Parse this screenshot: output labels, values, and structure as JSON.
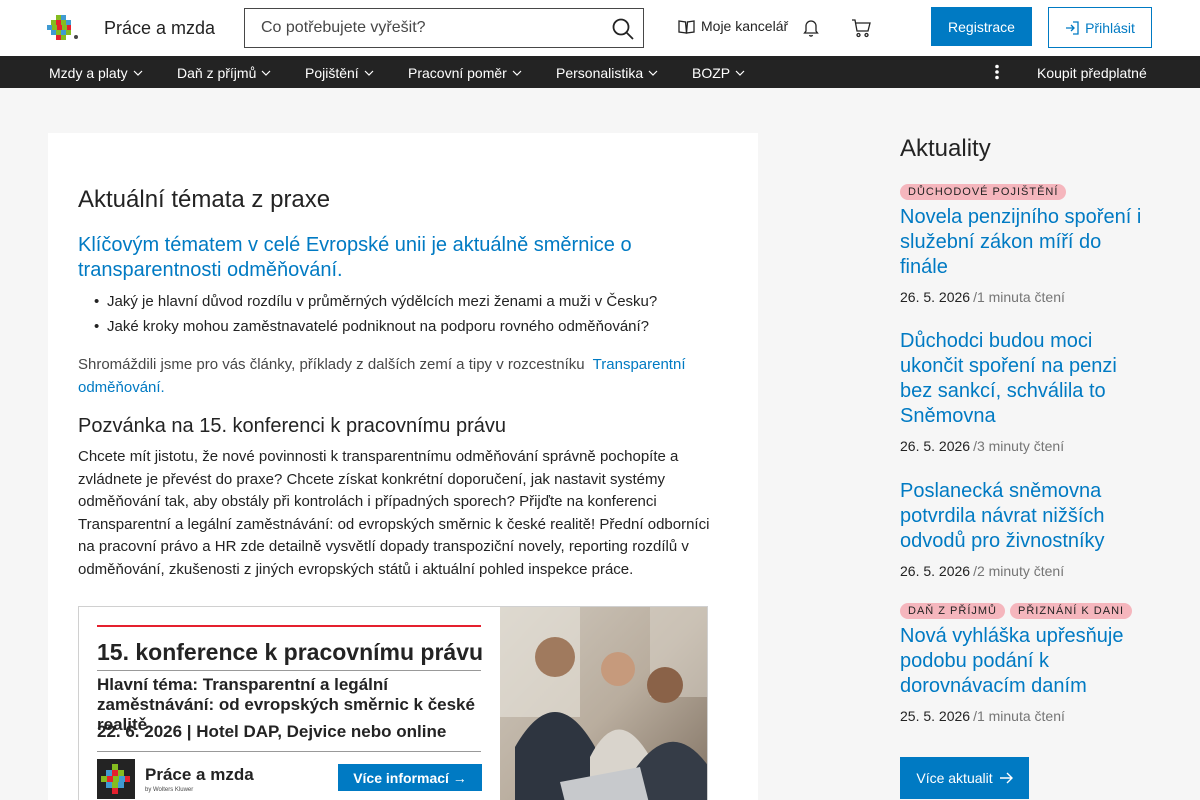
{
  "header": {
    "brand": "Práce a mzda",
    "search_placeholder": "Co potřebujete vyřešit?",
    "office_label": "Moje kancelář",
    "register_label": "Registrace",
    "login_label": "Přihlásit"
  },
  "nav": {
    "items": [
      {
        "label": "Mzdy a platy"
      },
      {
        "label": "Daň z příjmů"
      },
      {
        "label": "Pojištění"
      },
      {
        "label": "Pracovní poměr"
      },
      {
        "label": "Personalistika"
      },
      {
        "label": "BOZP"
      }
    ],
    "buy_label": "Koupit předplatné"
  },
  "main": {
    "title": "Aktuální témata z praxe",
    "lead_link": "Klíčovým tématem v celé Evropské unii je aktuálně směrnice o transparentnosti odměňování.",
    "bullets": [
      "Jaký je hlavní důvod rozdílu v průměrných výdělcích mezi ženami a muži v Česku?",
      "Jaké kroky mohou zaměstnavatelé podniknout na podporu rovného odměňování?"
    ],
    "para1_text": "Shromáždili jsme pro vás články, příklady z dalších zemí a tipy v rozcestníku",
    "para1_link": "Transparentní odměňování.",
    "heading2": "Pozvánka na 15. konferenci k pracovnímu právu",
    "para2": "Chcete mít jistotu, že nové povinnosti k transparentnímu odměňování správně pochopíte a zvládnete je převést do praxe? Chcete získat konkrétní doporučení, jak nastavit systémy odměňování tak, aby obstály při kontrolách i případných sporech? Přijďte na konferenci Transparentní a legální zaměstnávání: od evropských směrnic k české realitě! Přední odborníci na pracovní právo a HR zde detailně vysvětlí dopady transpoziční novely, reporting rozdílů v odměňování, zkušenosti z jiných evropských států i aktuální pohled inspekce práce."
  },
  "banner": {
    "title": "15. konference k pracovnímu právu",
    "subtitle": "Hlavní téma: Transparentní a legální zaměstnávání: od evropských směrnic k české realitě",
    "date_place": "22. 6. 2026 | Hotel DAP, Dejvice nebo online",
    "brand": "Práce a mzda",
    "brand_sub": "by Wolters Kluwer",
    "cta": "Více informací →"
  },
  "sidebar": {
    "title": "Aktuality",
    "news": [
      {
        "tags": [
          "DŮCHODOVÉ POJIŠTĚNÍ"
        ],
        "title": "Novela penzijního spoření i služební zákon míří do finále",
        "date": "26. 5. 2026",
        "read": "/1 minuta čtení"
      },
      {
        "tags": [],
        "title": "Důchodci budou moci ukončit spoření na penzi bez sankcí, schválila to Sněmovna",
        "date": "26. 5. 2026",
        "read": "/3 minuty čtení"
      },
      {
        "tags": [],
        "title": "Poslanecká sněmovna potvrdila návrat nižších odvodů pro živnostníky",
        "date": "26. 5. 2026",
        "read": "/2 minuty čtení"
      },
      {
        "tags": [
          "DAŇ Z PŘÍJMŮ",
          "PŘIZNÁNÍ K DANI"
        ],
        "title": "Nová vyhláška upřesňuje podobu podání k dorovnávacím daním",
        "date": "25. 5. 2026",
        "read": "/1 minuta čtení"
      }
    ],
    "more_label": "Více aktualit"
  },
  "colors": {
    "accent": "#007ac3",
    "nav_bg": "#232323",
    "tag_bg": "#f5b6bd",
    "page_bg": "#f6f6f6"
  }
}
